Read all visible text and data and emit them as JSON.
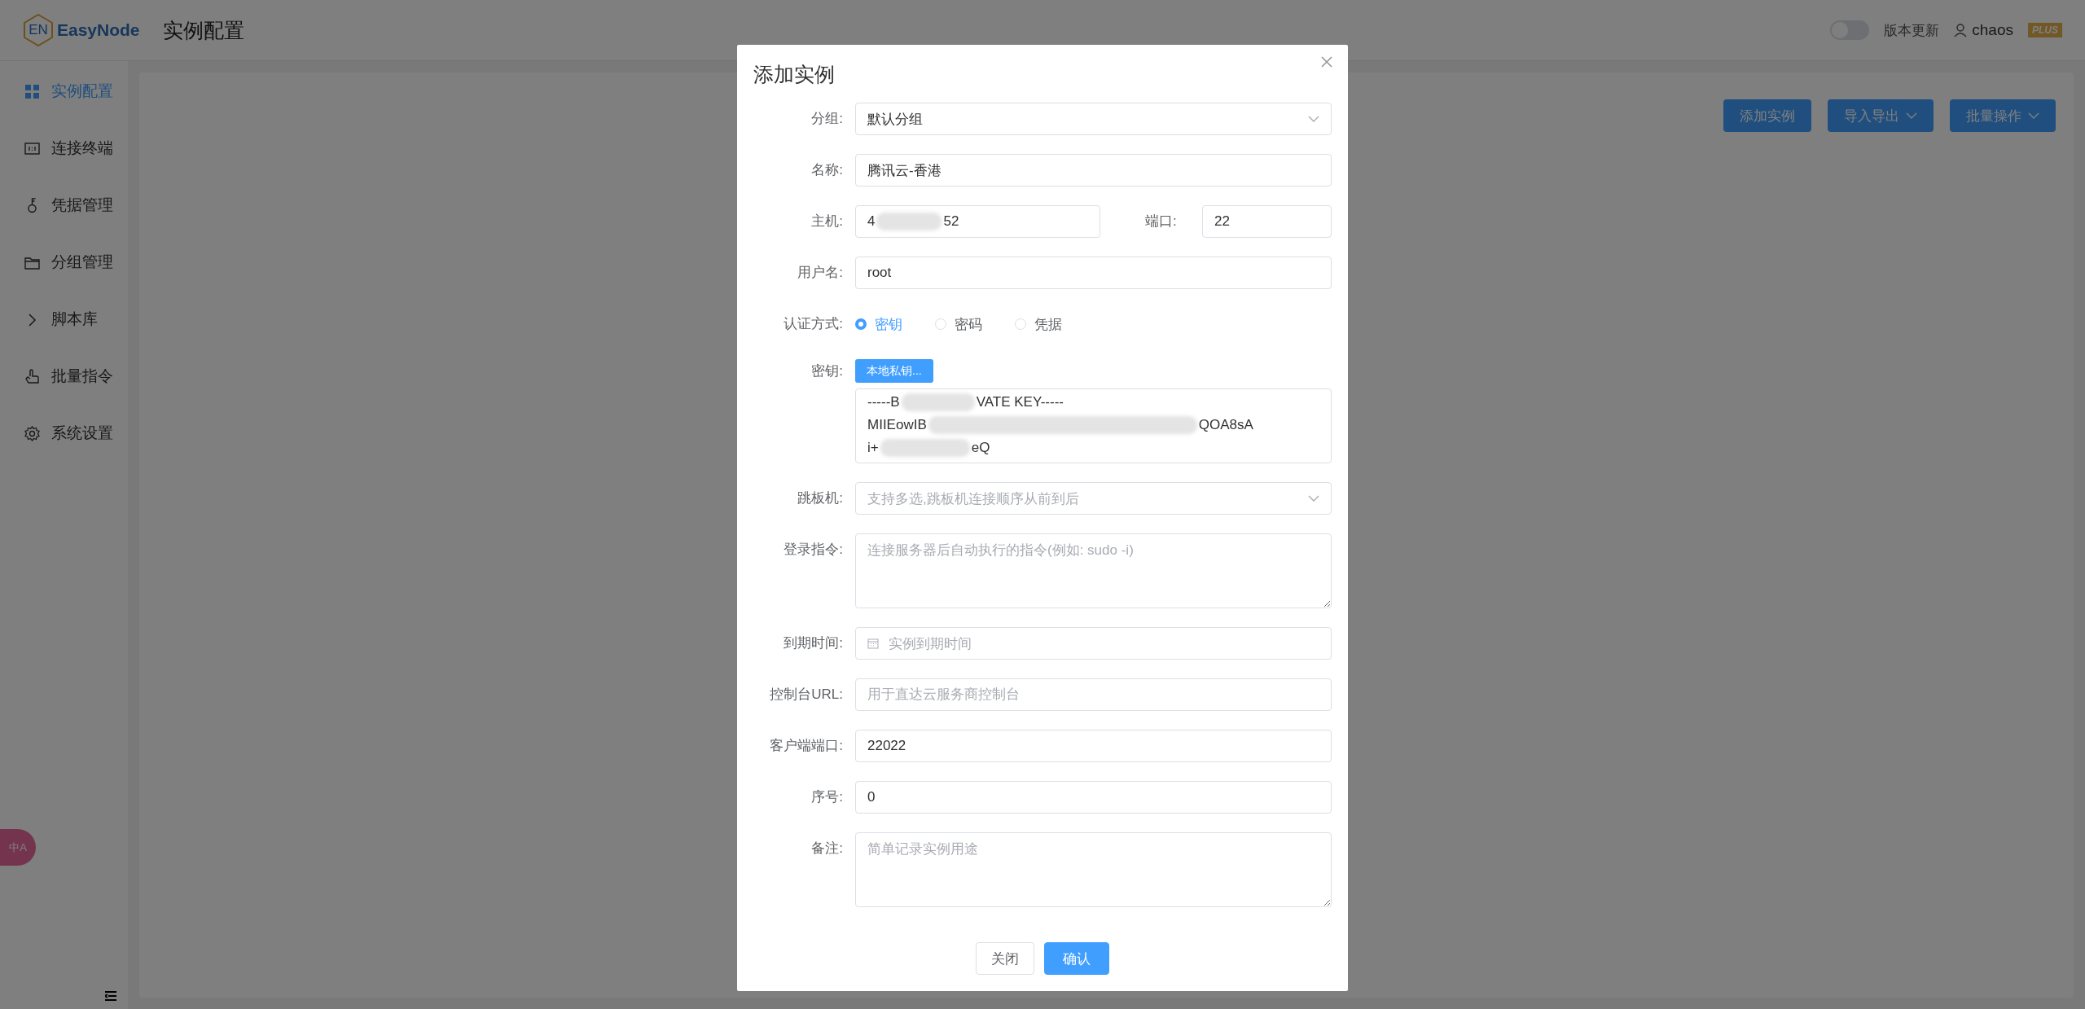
{
  "header": {
    "logo_text": "EN",
    "brand": "EasyNode",
    "page_title": "实例配置",
    "theme_switch": {
      "on": false
    },
    "update_link": "版本更新",
    "user": "chaos",
    "plan_badge": "PLUS"
  },
  "sidebar": {
    "items": [
      {
        "label": "实例配置",
        "selected": true
      },
      {
        "label": "连接终端",
        "selected": false
      },
      {
        "label": "凭据管理",
        "selected": false
      },
      {
        "label": "分组管理",
        "selected": false
      },
      {
        "label": "脚本库",
        "selected": false
      },
      {
        "label": "批量指令",
        "selected": false
      },
      {
        "label": "系统设置",
        "selected": false
      }
    ]
  },
  "toolbar": {
    "buttons": [
      {
        "label": "添加实例",
        "dropdown": false
      },
      {
        "label": "导入导出",
        "dropdown": true
      },
      {
        "label": "批量操作",
        "dropdown": true
      }
    ]
  },
  "language_badge": {
    "text": "中A"
  },
  "dialog": {
    "title": "添加实例",
    "fields": [
      {
        "kind": "select",
        "label": "分组:",
        "value": "默认分组"
      },
      {
        "kind": "input",
        "label": "名称:",
        "value": "腾讯云-香港"
      },
      {
        "kind": "host_port",
        "label": "主机:",
        "value_parts": [
          "4",
          "52"
        ],
        "port_label": "端口:",
        "port_value": "22"
      },
      {
        "kind": "input",
        "label": "用户名:",
        "value": "root"
      },
      {
        "kind": "radio",
        "label": "认证方式:",
        "options": [
          {
            "label": "密钥",
            "selected": true
          },
          {
            "label": "密码",
            "selected": false
          },
          {
            "label": "凭据",
            "selected": false
          }
        ]
      },
      {
        "kind": "key",
        "label": "密钥:",
        "button": "本地私钥...",
        "lines": [
          [
            "-----B",
            "VATE KEY-----"
          ],
          [
            "MIIEowIB",
            "QOA8sA"
          ],
          [
            "i+",
            "eQ"
          ]
        ]
      },
      {
        "kind": "select",
        "label": "跳板机:",
        "placeholder": "支持多选,跳板机连接顺序从前到后"
      },
      {
        "kind": "textarea",
        "label": "登录指令:",
        "placeholder": "连接服务器后自动执行的指令(例如: sudo -i)"
      },
      {
        "kind": "date",
        "label": "到期时间:",
        "placeholder": "实例到期时间"
      },
      {
        "kind": "input",
        "label": "控制台URL:",
        "placeholder": "用于直达云服务商控制台"
      },
      {
        "kind": "input",
        "label": "客户端端口:",
        "value": "22022"
      },
      {
        "kind": "input",
        "label": "序号:",
        "value": "0"
      },
      {
        "kind": "textarea",
        "label": "备注:",
        "placeholder": "简单记录实例用途"
      }
    ],
    "buttons": [
      {
        "label": "关闭",
        "primary": false
      },
      {
        "label": "确认",
        "primary": true
      }
    ]
  }
}
